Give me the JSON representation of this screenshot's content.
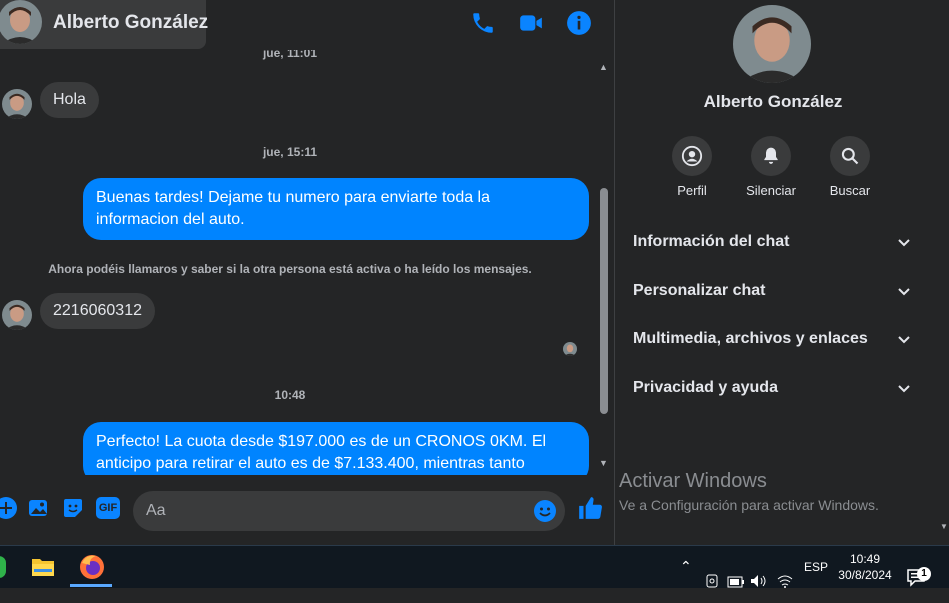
{
  "contact": {
    "name": "Alberto González"
  },
  "header": {
    "icons": [
      "phone-icon",
      "video-icon",
      "info-icon"
    ]
  },
  "messages": {
    "partial_timestamp": "jue, 11:01",
    "items": [
      {
        "direction": "in",
        "text": "Hola"
      },
      {
        "type": "timestamp",
        "text": "jue, 15:11"
      },
      {
        "direction": "out",
        "text": "Buenas tardes! Dejame tu numero para enviarte toda la informacion del auto."
      },
      {
        "type": "notice",
        "text": "Ahora podéis llamaros y saber si la otra persona está activa o ha leído los mensajes."
      },
      {
        "direction": "in",
        "text": "2216060312"
      },
      {
        "type": "timestamp",
        "text": "10:48"
      },
      {
        "direction": "out",
        "text": "Perfecto! La cuota desde $197.000 es de un CRONOS 0KM. El anticipo para retirar el auto es de $7.133.400, mientras tanto"
      }
    ]
  },
  "composer": {
    "placeholder": "Aa",
    "icons": [
      "plus-icon",
      "photo-icon",
      "sticker-icon",
      "gif-icon",
      "emoji-icon",
      "like-icon"
    ],
    "gif_label": "GIF"
  },
  "side_panel": {
    "name": "Alberto González",
    "actions": [
      {
        "label": "Perfil",
        "icon": "profile-icon"
      },
      {
        "label": "Silenciar",
        "icon": "bell-icon"
      },
      {
        "label": "Buscar",
        "icon": "search-icon"
      }
    ],
    "sections": [
      {
        "label": "Información del chat"
      },
      {
        "label": "Personalizar chat"
      },
      {
        "label": "Multimedia, archivos y enlaces"
      },
      {
        "label": "Privacidad y ayuda"
      }
    ]
  },
  "watermark": {
    "title": "Activar Windows",
    "subtitle": "Ve a Configuración para activar Windows."
  },
  "taskbar": {
    "language": "ESP",
    "time": "10:49",
    "date": "30/8/2024",
    "notification_count": "1"
  },
  "colors": {
    "accent": "#0084ff",
    "background": "#242526",
    "bubble_in": "#3a3b3c",
    "text": "#e4e6eb",
    "muted": "#b0b3b8"
  }
}
